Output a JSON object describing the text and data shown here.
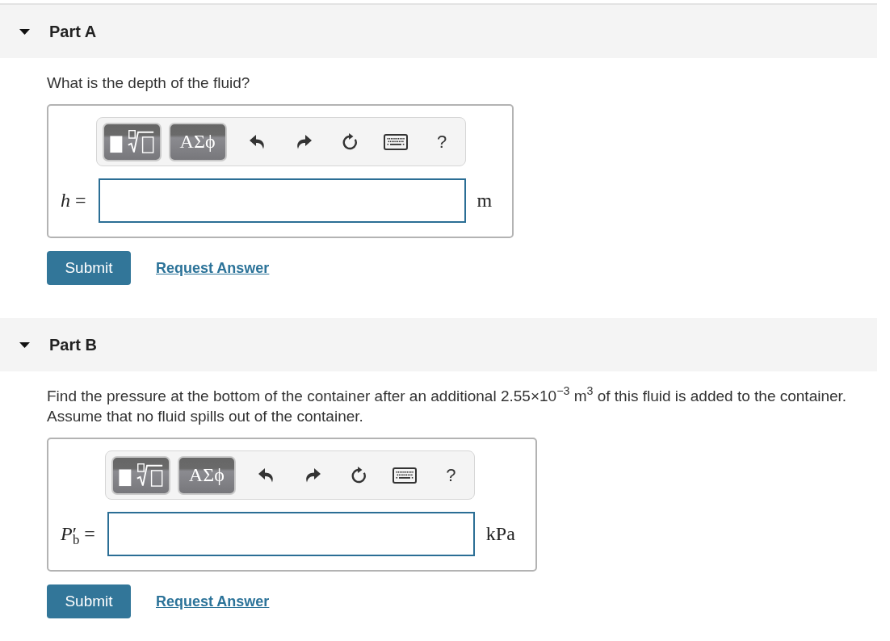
{
  "parts": [
    {
      "title": "Part A",
      "expanded": true,
      "question": "What is the depth of the fluid?",
      "toolbar": [
        {
          "kind": "templates"
        },
        {
          "kind": "symbols",
          "label": "ΑΣϕ"
        },
        {
          "kind": "undo"
        },
        {
          "kind": "redo"
        },
        {
          "kind": "reset"
        },
        {
          "kind": "keyboard"
        },
        {
          "kind": "help",
          "label": "?"
        }
      ],
      "answer": {
        "label": "*h* =",
        "unit": "m"
      },
      "submit": "Submit",
      "request_answer": "Request Answer"
    },
    {
      "title": "Part B",
      "expanded": true,
      "question": "Find the pressure at the bottom of the container after an additional 2.55×10$^{−3}$ m$^{3}$ of this fluid is added to the container. Assume that no fluid spills out of the container.",
      "toolbar": [
        {
          "kind": "templates"
        },
        {
          "kind": "symbols",
          "label": "ΑΣϕ"
        },
        {
          "kind": "undo"
        },
        {
          "kind": "redo"
        },
        {
          "kind": "reset"
        },
        {
          "kind": "keyboard"
        },
        {
          "kind": "help",
          "label": "?"
        }
      ],
      "answer": {
        "label": "*P*′$_{b}$ =",
        "unit": "kPa"
      },
      "submit": "Submit",
      "request_answer": "Request Answer"
    }
  ]
}
